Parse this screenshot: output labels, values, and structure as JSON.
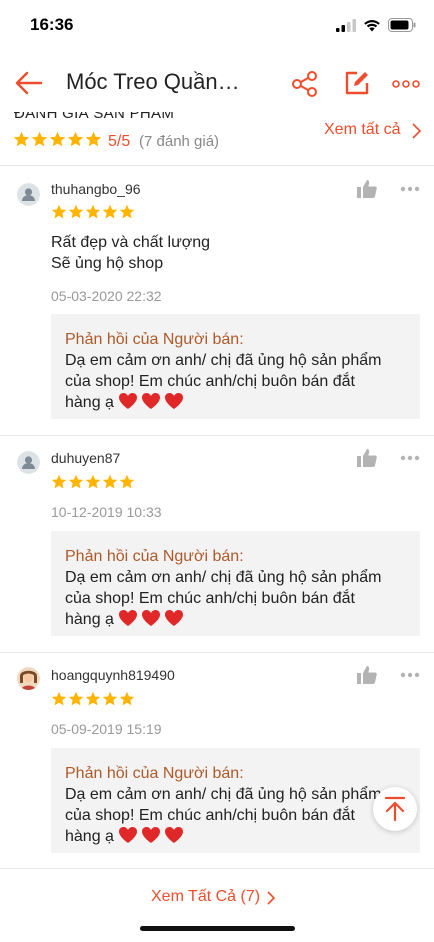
{
  "status_bar": {
    "time": "16:36"
  },
  "header": {
    "title": "Móc Treo Quần…"
  },
  "summary": {
    "title": "ĐÁNH GIÁ SẢN PHẨM",
    "score": "5/5",
    "count": "(7 đánh giá)",
    "see_all": "Xem tất cả",
    "stars": 5
  },
  "reviews": [
    {
      "username": "thuhangbo_96",
      "stars": 5,
      "comment_lines": [
        "Rất đẹp và chất lượng",
        "Sẽ ủng hộ shop"
      ],
      "date": "05-03-2020 22:32",
      "reply_title": "Phản hồi của Người bán:",
      "reply_lines": [
        "Dạ em cảm ơn anh/ chị đã ủng hộ sản phẩm",
        "của shop! Em chúc anh/chị buôn bán đắt",
        "hàng ạ"
      ]
    },
    {
      "username": "duhuyen87",
      "stars": 5,
      "comment_lines": [],
      "date": "10-12-2019 10:33",
      "reply_title": "Phản hồi của Người bán:",
      "reply_lines": [
        "Dạ em cảm ơn anh/ chị đã ủng hộ sản phẩm",
        "của shop! Em chúc anh/chị buôn bán đắt",
        "hàng ạ"
      ]
    },
    {
      "username": "hoangquynh819490",
      "stars": 5,
      "comment_lines": [],
      "date": "05-09-2019 15:19",
      "reply_title": "Phản hồi của Người bán:",
      "reply_lines": [
        "Dạ em cảm ơn anh/ chị đã ủng hộ sản phẩm",
        "của shop! Em chúc anh/chị buôn bán đắt",
        "hàng ạ"
      ]
    }
  ],
  "footer": {
    "see_all": "Xem Tất Cả (7)"
  },
  "colors": {
    "accent": "#ee4d2d",
    "star": "#ffb400",
    "reply_title": "#ad5a2a",
    "heart": "#e02828"
  },
  "icons": [
    "back-arrow-icon",
    "share-icon",
    "edit-icon",
    "more-icon",
    "thumbs-up-icon",
    "heart-icon",
    "scroll-top-icon"
  ]
}
